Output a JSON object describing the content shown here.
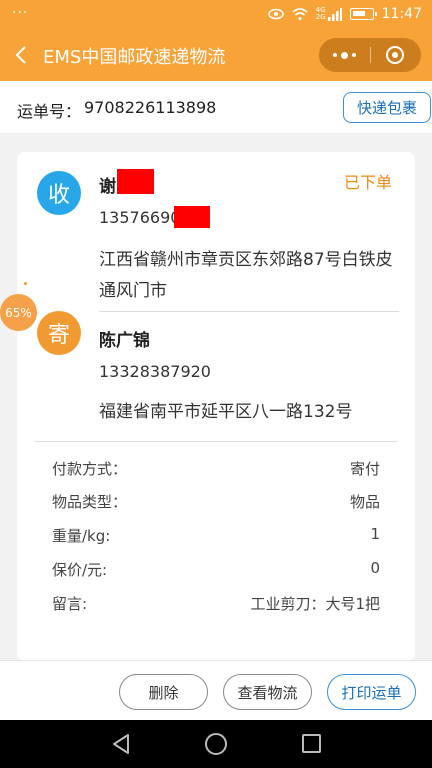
{
  "status_bar": {
    "dots": "···",
    "signal_top": "4G",
    "signal_bottom": "2G",
    "time": "11:47"
  },
  "header": {
    "title": "EMS中国邮政速递物流",
    "back_icon": "chevron-left-icon",
    "more_icon": "more-dots-icon",
    "close_icon": "target-circle-icon"
  },
  "waybill": {
    "label": "运单号：",
    "number": "9708226113898",
    "package_button": "快递包裹"
  },
  "order": {
    "status": "已下单",
    "receiver": {
      "badge": "收",
      "name": "谢",
      "phone": "13576690",
      "address": "江西省赣州市章贡区东郊路87号白铁皮通风门市"
    },
    "sender": {
      "badge": "寄",
      "name": "陈广锦",
      "phone": "13328387920",
      "address": "福建省南平市延平区八一路132号"
    },
    "details": [
      {
        "key": "付款方式：",
        "value": "寄付"
      },
      {
        "key": "物品类型：",
        "value": "物品"
      },
      {
        "key": "重量/kg:",
        "value": "1"
      },
      {
        "key": "保价/元:",
        "value": "0"
      },
      {
        "key": "留言:",
        "value": "工业剪刀：大号1把"
      }
    ]
  },
  "floating_badge": "65%",
  "actions": {
    "delete": "删除",
    "view_logistics": "查看物流",
    "print_waybill": "打印运单"
  },
  "colors": {
    "accent": "#f7a337",
    "receiver_badge": "#27a7e8",
    "sender_badge": "#f29a32",
    "status": "#f08b14",
    "link_blue": "#3b8fd6"
  }
}
